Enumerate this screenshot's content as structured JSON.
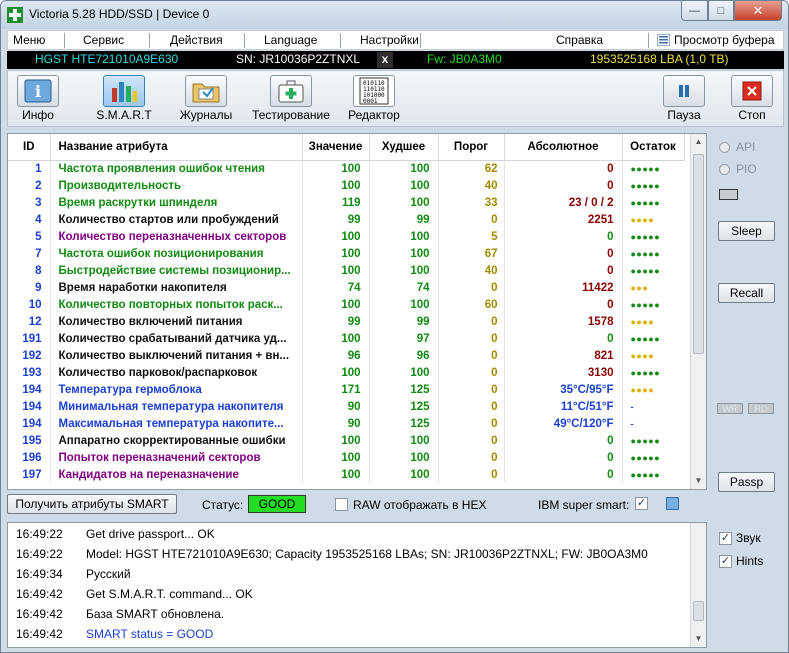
{
  "window": {
    "title": "Victoria 5.28 HDD/SSD | Device 0",
    "min": "—",
    "max": "□",
    "close": "✕"
  },
  "menu": {
    "items": [
      "Меню",
      "Сервис",
      "Действия",
      "Language",
      "Настройки",
      "Справка"
    ],
    "buffer": "Просмотр буфера"
  },
  "device": {
    "model": "HGST HTE721010A9E630",
    "sn": "SN: JR10036P2ZTNXL",
    "x": "x",
    "fw": "Fw: JB0A3M0",
    "capacity": "1953525168 LBA (1,0 TB)"
  },
  "toolbar": {
    "info": "Инфо",
    "smart": "S.M.A.R.T",
    "logs": "Журналы",
    "tests": "Тестирование",
    "editor": "Редактор",
    "pause": "Пауза",
    "stop": "Стоп",
    "editor_icon_text": "010110\n110110\n101000\n0001"
  },
  "table": {
    "headers": {
      "id": "ID",
      "name": "Название атрибута",
      "value": "Значение",
      "worst": "Худшее",
      "threshold": "Порог",
      "absolute": "Абсолютное",
      "remaining": "Остаток"
    },
    "rows": [
      {
        "id": "1",
        "name": "Частота проявления ошибок чтения",
        "value": "100",
        "worst": "100",
        "thr": "62",
        "abs": "0",
        "rem": "●●●●●",
        "nc": "#118a11",
        "ac": "#8b0000",
        "rc": "#118a11"
      },
      {
        "id": "2",
        "name": "Производительность",
        "value": "100",
        "worst": "100",
        "thr": "40",
        "abs": "0",
        "rem": "●●●●●",
        "nc": "#118a11",
        "ac": "#8b0000",
        "rc": "#118a11"
      },
      {
        "id": "3",
        "name": "Время раскрутки шпинделя",
        "value": "119",
        "worst": "100",
        "thr": "33",
        "abs": "23 / 0 / 2",
        "rem": "●●●●●",
        "nc": "#118a11",
        "ac": "#8b0000",
        "rc": "#118a11"
      },
      {
        "id": "4",
        "name": "Количество стартов или пробуждений",
        "value": "99",
        "worst": "99",
        "thr": "0",
        "abs": "2251",
        "rem": "●●●●",
        "nc": "#111111",
        "ac": "#8b0000",
        "rc": "#e0b000"
      },
      {
        "id": "5",
        "name": "Количество переназначенных секторов",
        "value": "100",
        "worst": "100",
        "thr": "5",
        "abs": "0",
        "rem": "●●●●●",
        "nc": "#800080",
        "ac": "#118a11",
        "rc": "#118a11"
      },
      {
        "id": "7",
        "name": "Частота ошибок позиционирования",
        "value": "100",
        "worst": "100",
        "thr": "67",
        "abs": "0",
        "rem": "●●●●●",
        "nc": "#118a11",
        "ac": "#8b0000",
        "rc": "#118a11"
      },
      {
        "id": "8",
        "name": "Быстродействие системы позиционир...",
        "value": "100",
        "worst": "100",
        "thr": "40",
        "abs": "0",
        "rem": "●●●●●",
        "nc": "#118a11",
        "ac": "#8b0000",
        "rc": "#118a11"
      },
      {
        "id": "9",
        "name": "Время наработки накопителя",
        "value": "74",
        "worst": "74",
        "thr": "0",
        "abs": "11422",
        "rem": "●●●",
        "nc": "#111111",
        "ac": "#8b0000",
        "rc": "#e0b000"
      },
      {
        "id": "10",
        "name": "Количество повторных попыток раск...",
        "value": "100",
        "worst": "100",
        "thr": "60",
        "abs": "0",
        "rem": "●●●●●",
        "nc": "#118a11",
        "ac": "#8b0000",
        "rc": "#118a11"
      },
      {
        "id": "12",
        "name": "Количество включений питания",
        "value": "99",
        "worst": "99",
        "thr": "0",
        "abs": "1578",
        "rem": "●●●●",
        "nc": "#111111",
        "ac": "#8b0000",
        "rc": "#e0b000"
      },
      {
        "id": "191",
        "name": "Количество срабатываний датчика уд...",
        "value": "100",
        "worst": "97",
        "thr": "0",
        "abs": "0",
        "rem": "●●●●●",
        "nc": "#111111",
        "ac": "#118a11",
        "rc": "#118a11"
      },
      {
        "id": "192",
        "name": "Количество выключений питания + вн...",
        "value": "96",
        "worst": "96",
        "thr": "0",
        "abs": "821",
        "rem": "●●●●",
        "nc": "#111111",
        "ac": "#8b0000",
        "rc": "#e0b000"
      },
      {
        "id": "193",
        "name": "Количество парковок/распарковок",
        "value": "100",
        "worst": "100",
        "thr": "0",
        "abs": "3130",
        "rem": "●●●●●",
        "nc": "#111111",
        "ac": "#8b0000",
        "rc": "#118a11"
      },
      {
        "id": "194",
        "name": "Температура гермоблока",
        "value": "171",
        "worst": "125",
        "thr": "0",
        "abs": "35°C/95°F",
        "rem": "●●●●",
        "nc": "#1a3fd1",
        "ac": "#1a3fd1",
        "rc": "#e0b000"
      },
      {
        "id": "194",
        "name": "Минимальная температура накопителя",
        "value": "90",
        "worst": "125",
        "thr": "0",
        "abs": "11°C/51°F",
        "rem": "-",
        "nc": "#1a3fd1",
        "ac": "#1a3fd1",
        "rc": "#1a3fd1"
      },
      {
        "id": "194",
        "name": "Максимальная температура накопите...",
        "value": "90",
        "worst": "125",
        "thr": "0",
        "abs": "49°C/120°F",
        "rem": "-",
        "nc": "#1a3fd1",
        "ac": "#1a3fd1",
        "rc": "#1a3fd1"
      },
      {
        "id": "195",
        "name": "Аппаратно скорректированные ошибки",
        "value": "100",
        "worst": "100",
        "thr": "0",
        "abs": "0",
        "rem": "●●●●●",
        "nc": "#111111",
        "ac": "#118a11",
        "rc": "#118a11"
      },
      {
        "id": "196",
        "name": "Попыток переназначений секторов",
        "value": "100",
        "worst": "100",
        "thr": "0",
        "abs": "0",
        "rem": "●●●●●",
        "nc": "#800080",
        "ac": "#118a11",
        "rc": "#118a11"
      },
      {
        "id": "197",
        "name": "Кандидатов на переназначение",
        "value": "100",
        "worst": "100",
        "thr": "0",
        "abs": "0",
        "rem": "●●●●●",
        "nc": "#800080",
        "ac": "#118a11",
        "rc": "#118a11"
      }
    ]
  },
  "bottom": {
    "get_smart": "Получить атрибуты SMART",
    "status_label": "Статус:",
    "status_value": "GOOD",
    "raw_hex": "RAW отображать в HEX",
    "ibm": "IBM super smart:",
    "ibm_check": "✓"
  },
  "side": {
    "api": "API",
    "pio": "PIO",
    "sleep": "Sleep",
    "recall": "Recall",
    "wr": "WR",
    "rd": "RD",
    "passp": "Passp"
  },
  "log": [
    {
      "t": "16:49:22",
      "m": "Get drive passport... OK",
      "c": "#000000"
    },
    {
      "t": "16:49:22",
      "m": "Model: HGST HTE721010A9E630; Capacity 1953525168 LBAs; SN: JR10036P2ZTNXL; FW: JB0OA3M0",
      "c": "#000000"
    },
    {
      "t": "16:49:34",
      "m": "Русский",
      "c": "#000000"
    },
    {
      "t": "16:49:42",
      "m": "Get S.M.A.R.T. command... OK",
      "c": "#000000"
    },
    {
      "t": "16:49:42",
      "m": "База SMART обновлена.",
      "c": "#000000"
    },
    {
      "t": "16:49:42",
      "m": "SMART status = GOOD",
      "c": "#1a3fd1"
    }
  ],
  "options": {
    "sound": "Звук",
    "hints": "Hints",
    "check": "✓"
  },
  "colors": {
    "status_good": "#22dd22",
    "infobar_model": "#33dddd",
    "infobar_fw": "#22dd22",
    "infobar_capacity": "#f0e040"
  }
}
